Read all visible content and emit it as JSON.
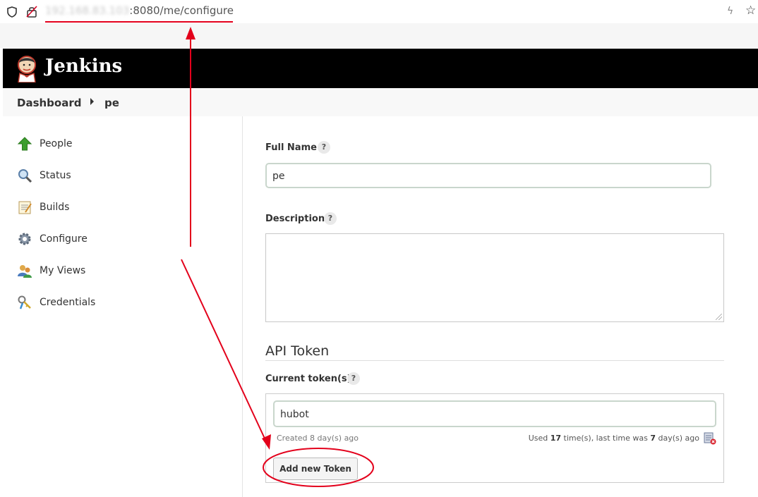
{
  "browser": {
    "url_host_blurred": "192.168.83.103",
    "url_rest": ":8080/me/configure"
  },
  "header": {
    "brand": "Jenkins"
  },
  "breadcrumb": {
    "items": [
      "Dashboard",
      "pe"
    ]
  },
  "sidebar": {
    "items": [
      {
        "label": "People",
        "icon": "up-arrow-icon"
      },
      {
        "label": "Status",
        "icon": "magnifier-icon"
      },
      {
        "label": "Builds",
        "icon": "notepad-icon"
      },
      {
        "label": "Configure",
        "icon": "gear-icon"
      },
      {
        "label": "My Views",
        "icon": "users-icon"
      },
      {
        "label": "Credentials",
        "icon": "keys-icon"
      }
    ]
  },
  "form": {
    "full_name_label": "Full Name",
    "full_name_value": "pe",
    "description_label": "Description",
    "description_value": "",
    "help_symbol": "?",
    "api_token_title": "API Token",
    "current_tokens_label": "Current token(s)",
    "token": {
      "name": "hubot",
      "created_text": "Created 8 day(s) ago",
      "used_prefix": "Used ",
      "used_count": "17",
      "used_mid": " time(s), last time was ",
      "used_days": "7",
      "used_suffix": " day(s) ago"
    },
    "add_token_label": "Add new Token"
  },
  "annotation_colors": {
    "red": "#e3001b"
  }
}
